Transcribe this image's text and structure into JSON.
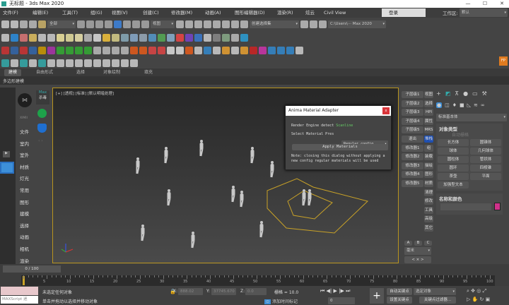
{
  "window": {
    "title": "无标题 - 3ds Max 2020",
    "min": "—",
    "max": "☐",
    "close": "✕"
  },
  "menu": [
    "文件(F)",
    "编辑(E)",
    "工具(T)",
    "组(G)",
    "视图(V)",
    "创建(C)",
    "修改器(M)",
    "动画(A)",
    "图形编辑器(D)",
    "渲染(R)",
    "炫云",
    "Civil View"
  ],
  "account": {
    "login": "登录",
    "workspace_label": "工作区:",
    "workspace_value": "默认"
  },
  "toolbar1": {
    "filter": "全部",
    "refcoord": "视图",
    "selset": "创建选择集",
    "path": "C:\\Users\\··· Max 2020"
  },
  "toolbar_icons": {
    "row1": [
      [
        "undo-icon",
        "#ccc"
      ],
      [
        "redo-icon",
        "#ccc"
      ],
      [
        "link-icon",
        "#bbb"
      ],
      [
        "unlink-icon",
        "#bbb"
      ],
      [
        "bind-space-warp-icon",
        "#ccb36a"
      ]
    ],
    "row2": [
      [
        "teapot-icon",
        "#ccc"
      ],
      [
        "app-icon",
        "#2a8ee0"
      ],
      [
        "render-frame-icon",
        "#d77"
      ],
      [
        "light-icon",
        "#e0c060"
      ],
      [
        "camera-icon",
        "#ccc"
      ],
      [
        "helper-icon",
        "#ccc"
      ],
      [
        "plane-light-icon",
        "#f2e8a0"
      ],
      [
        "dome-icon",
        "#e8e0a0"
      ],
      [
        "sphere-light-icon",
        "#eee6b0"
      ],
      [
        "teapot-light-icon",
        "#bbb"
      ],
      [
        "cone-icon",
        "#ddd"
      ],
      [
        "sun-icon",
        "#f2c23a"
      ],
      [
        "disc-icon",
        "#d8cf8a"
      ],
      [
        "grid-icon",
        "#8ab"
      ],
      [
        "water-drop-icon",
        "#8ac"
      ],
      [
        "compass-icon",
        "#9ab"
      ],
      [
        "snowflake-icon",
        "#59c"
      ],
      [
        "plant-icon",
        "#5a5"
      ],
      [
        "ball-icon",
        "#8ab0d0"
      ],
      [
        "dots-icon",
        "#e44"
      ],
      [
        "gear-purple-icon",
        "#74c"
      ],
      [
        "material-icon",
        "#3a7ad0"
      ],
      [
        "battery-icon",
        "#ccc"
      ],
      [
        "help-circle-icon",
        "#888"
      ],
      [
        "tree-icon",
        "#8a8"
      ],
      [
        "notes-icon",
        "#bbb"
      ],
      [
        "help-icon",
        "#2a9fd6"
      ]
    ],
    "row3": [
      [
        "shape-hex-icon",
        "#c33"
      ],
      [
        "hex-icon",
        "#36a"
      ],
      [
        "fire-outline-icon",
        "#c33"
      ],
      [
        "drop-outline-icon",
        "#36a"
      ],
      [
        "fan-icon",
        "#c90"
      ],
      [
        "box-outline-icon",
        "#a3a"
      ],
      [
        "globe-icon",
        "#3a3"
      ],
      [
        "arrow-right-icon",
        "#3a3"
      ],
      [
        "grid-green-icon",
        "#3a3"
      ],
      [
        "burst-icon",
        "#3a3"
      ],
      [
        "play-icon",
        "#bbb"
      ],
      [
        "pause-icon",
        "#bbb"
      ],
      [
        "stop-icon",
        "#bbb"
      ],
      [
        "trash-icon",
        "#bbb"
      ],
      [
        "fire-icon",
        "#e55a1a"
      ],
      [
        "fire2-icon",
        "#e55a1a"
      ],
      [
        "fire3-icon",
        "#d44"
      ],
      [
        "fire4-icon",
        "#d44"
      ],
      [
        "smoke-icon",
        "#ddd"
      ],
      [
        "smoke2-icon",
        "#ddd"
      ],
      [
        "fire5-icon",
        "#e55a1a"
      ],
      [
        "smoke3-icon",
        "#ccc"
      ],
      [
        "water-icon",
        "#38c"
      ],
      [
        "splash-icon",
        "#ccc"
      ],
      [
        "beer-icon",
        "#e8a030"
      ],
      [
        "coffee-icon",
        "#ccc"
      ],
      [
        "lava-icon",
        "#e8a030"
      ],
      [
        "blood-icon",
        "#c22"
      ],
      [
        "phone-icon",
        "#c3a"
      ],
      [
        "whirl-icon",
        "#38c"
      ],
      [
        "wave-icon",
        "#38c"
      ],
      [
        "sink-icon",
        "#38c"
      ],
      [
        "question-icon",
        "#ccc"
      ]
    ],
    "row4": [
      [
        "camera-rig-icon",
        "#3aa"
      ],
      [
        "camera2-icon",
        "#ccc"
      ],
      [
        "bulb-icon",
        "#3aa"
      ],
      [
        "spot-icon",
        "#ccc"
      ],
      [
        "trees-icon",
        "#3aa"
      ],
      [
        "tree2-icon",
        "#ccc"
      ],
      [
        "door-icon",
        "#ccc"
      ],
      [
        "bottle-icon",
        "#ccc"
      ],
      [
        "ring-icon",
        "#ccc"
      ],
      [
        "monitor-icon",
        "#ccc"
      ],
      [
        "lamp-icon",
        "#ccc"
      ],
      [
        "frame-icon",
        "#ccc"
      ],
      [
        "frame2-icon",
        "#ccc"
      ],
      [
        "window-icon",
        "#ccc"
      ],
      [
        "teapot-outline-icon",
        "#ccc"
      ]
    ]
  },
  "ribbon": {
    "tabs": [
      "建模",
      "自由形式",
      "选择",
      "对象绘制",
      "填充"
    ],
    "sub": "多边形建模"
  },
  "plugin": {
    "logo_text": "XIMII",
    "max_label": "Max",
    "antivirus": "杀毒",
    "items": [
      "文件",
      "室内",
      "室外",
      "材质",
      "灯光",
      "常用",
      "图形",
      "建模",
      "选择",
      "动画",
      "相机",
      "渲染"
    ]
  },
  "viewport": {
    "label": "[+] [透视] [标准] [默认明暗处理]"
  },
  "dialog": {
    "title": "Anima Material Adapter",
    "close": "x",
    "engine_label": "Render Engine detect",
    "engine_value": "Scanline",
    "preset_label": "Select Material Pres",
    "preset_value": "Regular config",
    "apply": "Apply Materials",
    "note": "Note: closing this dialog without applying a new config regular materials will be used"
  },
  "modcol": {
    "left": [
      "子层级1",
      "子层级2",
      "子层级3",
      "子层级4",
      "子层级5",
      "退出",
      "修改器1",
      "修改器2",
      "修改器3",
      "修改器4",
      "修改器5"
    ],
    "right": [
      "视图",
      "选择",
      "HPI",
      "属性",
      "MRS",
      "堆栈",
      "组",
      "装载",
      "描绘",
      "图形",
      "材质",
      "清理",
      "修改",
      "工具",
      "高级",
      "其它"
    ],
    "abc": [
      "A",
      "B",
      "C"
    ],
    "unit": "毫米"
  },
  "cmd": {
    "category": "标准基本体",
    "section1": "对象类型",
    "autogrid": "自动栅格",
    "objects": [
      "长方体",
      "圆锥体",
      "球体",
      "几何球体",
      "圆柱体",
      "管状体",
      "圆环",
      "四棱锥",
      "茶壶",
      "平面",
      "加强型文本"
    ],
    "section2": "名称和颜色",
    "color": "#d0308a"
  },
  "timeline": {
    "frame": "0 / 100",
    "ticks": [
      "0",
      "5",
      "10",
      "15",
      "20",
      "25",
      "30",
      "35",
      "40",
      "45",
      "50",
      "55",
      "60",
      "65",
      "70",
      "75",
      "80",
      "85",
      "90",
      "95",
      "100"
    ]
  },
  "status": {
    "maxscript": "MAXScript 迷",
    "msg1": "未选定任何对象",
    "msg2": "单击并拖动以选择并移动对象",
    "x_label": "X:",
    "x": "888.02",
    "y_label": "Y:",
    "y": "37745.670",
    "z_label": "Z:",
    "z": "0.0",
    "grid": "栅格 = 10.0",
    "add_tag": "添加时间标记",
    "frame_value": "0",
    "autokey": "自动关键点",
    "setkey": "设置关键点",
    "selected": "选定对象",
    "keyfilter": "关键点过滤器..."
  }
}
